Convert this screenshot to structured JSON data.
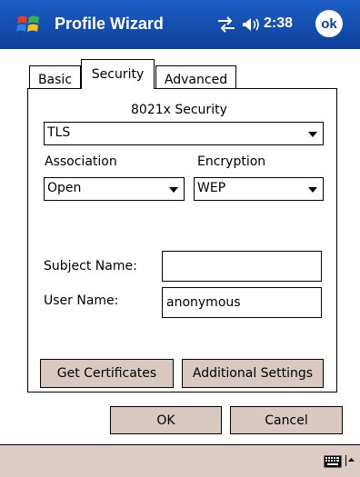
{
  "titlebar": {
    "title": "Profile Wizard",
    "clock": "2:38",
    "ok_label": "ok",
    "icons": [
      "windows-start-icon",
      "network-icon",
      "volume-icon"
    ]
  },
  "tabs": [
    {
      "label": "Basic",
      "active": false
    },
    {
      "label": "Security",
      "active": true
    },
    {
      "label": "Advanced",
      "active": false
    }
  ],
  "security": {
    "section_label": "8021x Security",
    "security_value": "TLS",
    "association_label": "Association",
    "association_value": "Open",
    "encryption_label": "Encryption",
    "encryption_value": "WEP",
    "subject_name_label": "Subject Name:",
    "subject_name_value": "",
    "user_name_label": "User Name:",
    "user_name_value": "anonymous",
    "get_certificates_label": "Get Certificates",
    "additional_settings_label": "Additional Settings"
  },
  "buttons": {
    "ok_label": "OK",
    "cancel_label": "Cancel"
  },
  "menubar": {
    "icons": [
      "keyboard-icon",
      "sip-up-arrow-icon"
    ]
  },
  "colors": {
    "titlebar": "#0e3f9a",
    "button_face": "#d9c9c0",
    "menubar": "#dcccc3"
  }
}
